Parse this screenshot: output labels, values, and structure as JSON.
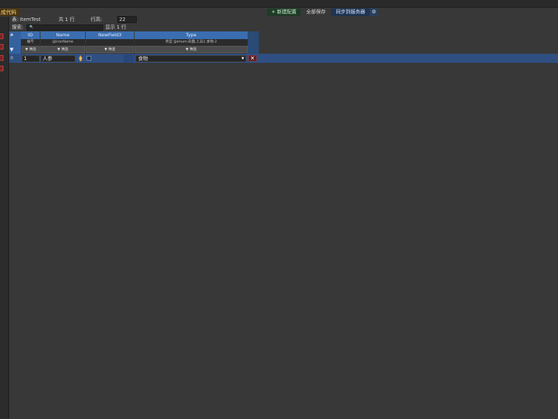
{
  "toolbar": {
    "generate_label": "成代码",
    "table_label": "表: ItemTest",
    "total_label": "共 1 行",
    "row_height_label": "行高:",
    "row_height_value": "22",
    "new_config_label": "+ 新建配置",
    "save_all_label": "全部保存",
    "sync_label": "同步到服务器",
    "settings_icon": "⚙"
  },
  "search": {
    "label": "搜索:",
    "icon": "🔍",
    "value": "",
    "showing_label": "显示 1 行"
  },
  "table": {
    "index_header": "#",
    "columns": [
      {
        "name": "ID",
        "subtitle": "编号",
        "filter": "▼ 筛选"
      },
      {
        "name": "Name",
        "subtitle": "@iconName",
        "filter": "▼ 筛选"
      },
      {
        "name": "NewField3",
        "subtitle": "",
        "filter": "▼ 筛选"
      },
      {
        "name": "Type",
        "subtitle": "类型 @enum:武器,工具1,食物:2",
        "filter": "▼ 筛选"
      }
    ],
    "filter_toggle": "▼",
    "rows": [
      {
        "index": "0",
        "id": "1",
        "name": "人参",
        "type": "食物",
        "delete": "✕"
      }
    ]
  },
  "colors": {
    "header_blue": "#3b6eb0",
    "selected_row": "#2f4f82",
    "generate_accent": "#4a3614",
    "delete_red": "#5a1e1e"
  }
}
